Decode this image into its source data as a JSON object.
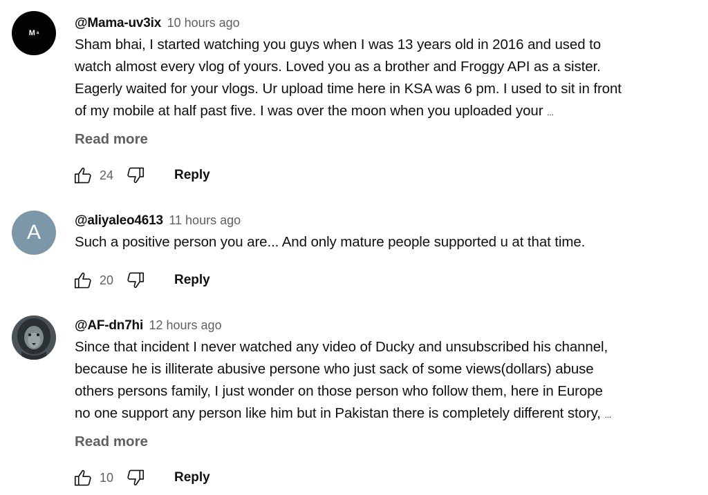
{
  "comments": [
    {
      "avatar_text": "M",
      "avatar_sup": "a",
      "author": "@Mama-uv3ix",
      "time": "10 hours ago",
      "lines": [
        "Sham bhai, I started watching you guys when I was 13 years old in 2016 and used to",
        "watch almost every vlog of yours. Loved you as a brother and Froggy API as a sister.",
        "Eagerly waited for your vlogs. Ur upload time here in KSA was 6 pm. I used to sit in front",
        "of my mobile at half past five. I was over the moon when you uploaded your"
      ],
      "ellipsis": "...",
      "read_more": "Read more",
      "likes": "24",
      "reply": "Reply"
    },
    {
      "avatar_text": "A",
      "author": "@aliyaleo4613",
      "time": "11 hours ago",
      "lines": [
        "Such a positive person you are... And only mature people supported u at that time."
      ],
      "likes": "20",
      "reply": "Reply"
    },
    {
      "avatar_icon": "lion-avatar-icon",
      "author": "@AF-dn7hi",
      "time": "12 hours ago",
      "lines": [
        "Since that incident I never watched any video of Ducky and unsubscribed his channel,",
        "because he is illiterate abusive persone who just sack of some views(dollars) abuse",
        "others persons family, I just wonder on those person who follow them, here in Europe",
        "no one support any person like him but in Pakistan there is completely different story,"
      ],
      "ellipsis": "...",
      "read_more": "Read more",
      "likes": "10",
      "reply": "Reply"
    }
  ],
  "colors": {
    "text": "#0f0f0f",
    "secondary": "#606060",
    "avatar_a_bg": "#7c97a8"
  }
}
